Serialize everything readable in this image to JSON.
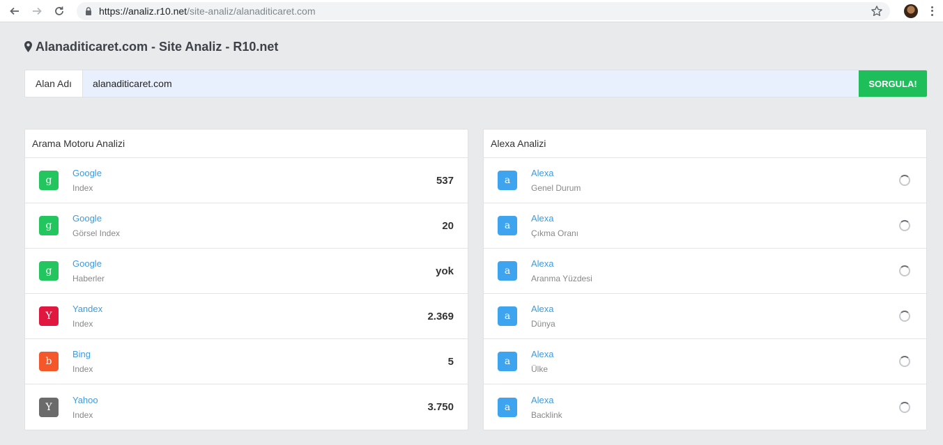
{
  "browser": {
    "url_host": "https://analiz.r10.net",
    "url_path": "/site-analiz/alanaditicaret.com"
  },
  "page_title": "Alanaditicaret.com - Site Analiz - R10.net",
  "search": {
    "label": "Alan Adı",
    "value": "alanaditicaret.com",
    "button": "SORGULA!"
  },
  "search_engine": {
    "title": "Arama Motoru Analizi",
    "rows": [
      {
        "icon": "g",
        "color": "#22c55e",
        "name": "Google",
        "sub": "Index",
        "value": "537"
      },
      {
        "icon": "g",
        "color": "#22c55e",
        "name": "Google",
        "sub": "Görsel Index",
        "value": "20"
      },
      {
        "icon": "g",
        "color": "#22c55e",
        "name": "Google",
        "sub": "Haberler",
        "value": "yok"
      },
      {
        "icon": "Y",
        "color": "#e0173f",
        "name": "Yandex",
        "sub": "Index",
        "value": "2.369"
      },
      {
        "icon": "b",
        "color": "#f4572a",
        "name": "Bing",
        "sub": "Index",
        "value": "5"
      },
      {
        "icon": "Y",
        "color": "#6b6b6b",
        "name": "Yahoo",
        "sub": "Index",
        "value": "3.750"
      }
    ]
  },
  "alexa": {
    "title": "Alexa Analizi",
    "rows": [
      {
        "icon": "a",
        "color": "#3fa4f0",
        "name": "Alexa",
        "sub": "Genel Durum"
      },
      {
        "icon": "a",
        "color": "#3fa4f0",
        "name": "Alexa",
        "sub": "Çıkma Oranı"
      },
      {
        "icon": "a",
        "color": "#3fa4f0",
        "name": "Alexa",
        "sub": "Aranma Yüzdesi"
      },
      {
        "icon": "a",
        "color": "#3fa4f0",
        "name": "Alexa",
        "sub": "Dünya"
      },
      {
        "icon": "a",
        "color": "#3fa4f0",
        "name": "Alexa",
        "sub": "Ülke"
      },
      {
        "icon": "a",
        "color": "#3fa4f0",
        "name": "Alexa",
        "sub": "Backlink"
      }
    ]
  }
}
